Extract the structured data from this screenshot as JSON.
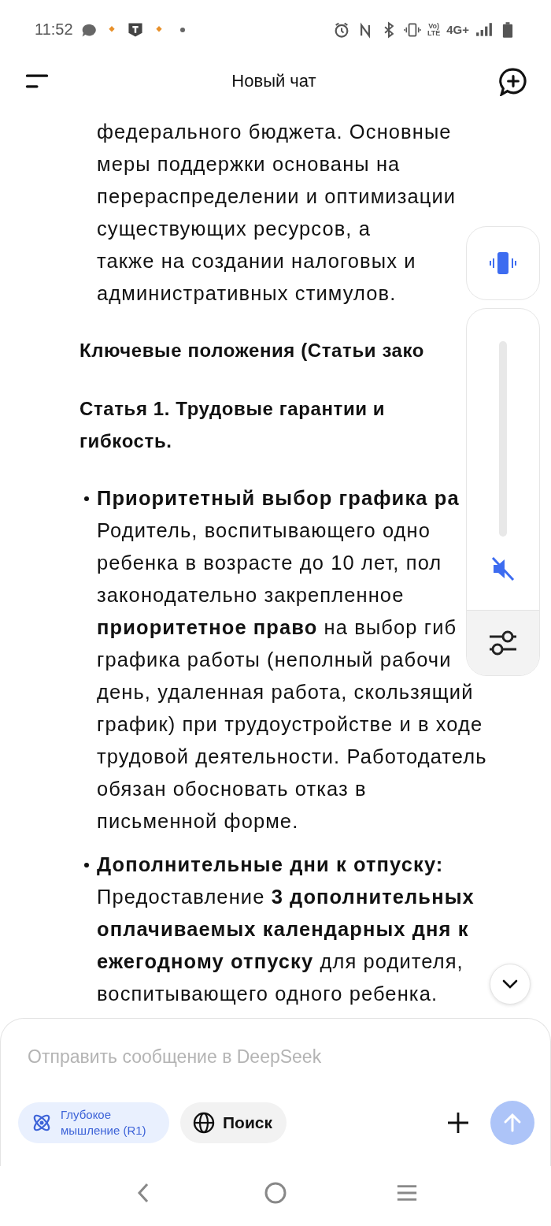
{
  "status_bar": {
    "time": "11:52",
    "volte": [
      "Vo)",
      "LTE"
    ],
    "network": "4G+"
  },
  "header": {
    "title": "Новый чат"
  },
  "message": {
    "blocks": [
      {
        "kind": "paragraph",
        "lines": [
          "федерального бюджета. Основные",
          "меры поддержки основаны на",
          "перераспределении и оптимизации",
          "существующих ресурсов, а",
          "также на создании налоговых и",
          "административных стимулов."
        ]
      },
      {
        "kind": "heading",
        "lines": [
          "Ключевые положения (Статьи зако"
        ]
      },
      {
        "kind": "heading",
        "lines": [
          "Статья 1. Трудовые гарантии и",
          "гибкость."
        ]
      },
      {
        "kind": "bullet",
        "lines": [
          "**Приоритетный выбор графика ра**",
          "Родитель, воспитывающего одно",
          "ребенка в возрасте до 10 лет, пол",
          "законодательно закрепленное",
          "**приоритетное право** на выбор гиб",
          "графика работы (неполный рабочи",
          "день, удаленная работа, скользящий",
          "график) при трудоустройстве и в ходе",
          "трудовой деятельности. Работодатель",
          "обязан обосновать отказ в",
          "письменной форме."
        ]
      },
      {
        "kind": "bullet",
        "lines": [
          "**Дополнительные дни к отпуску:**",
          "Предоставление **3 дополнительных**",
          "**оплачиваемых календарных дня к**",
          "**ежегодному отпуску** для родителя,",
          "воспитывающего одного ребенка."
        ]
      }
    ]
  },
  "volume_panel": {
    "mode_button": {
      "kind": "vibrate"
    },
    "slider": {
      "level": 0,
      "muted": true
    }
  },
  "composer": {
    "placeholder": "Отправить сообщение в DeepSeek",
    "chips": [
      {
        "kind": "deep_think",
        "label": "Глубокое мышление (R1)",
        "selected": true
      },
      {
        "kind": "search",
        "label": "Поиск",
        "selected": false
      }
    ],
    "send_disabled": true
  }
}
